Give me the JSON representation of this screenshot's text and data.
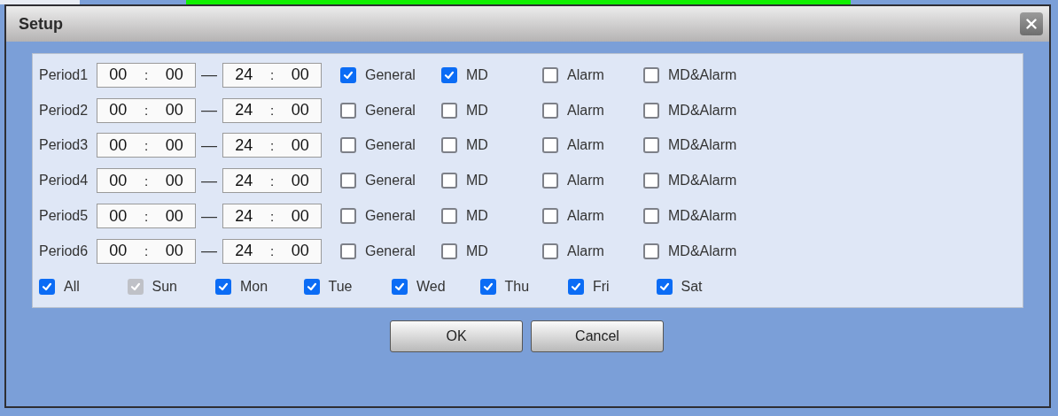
{
  "dialog": {
    "title": "Setup",
    "periods": [
      {
        "label": "Period1",
        "start": {
          "hour": "00",
          "sep": ":",
          "minute": "00"
        },
        "dash": "—",
        "end": {
          "hour": "24",
          "sep": ":",
          "minute": "00"
        },
        "options": [
          {
            "label": "General",
            "checked": true
          },
          {
            "label": "MD",
            "checked": true
          },
          {
            "label": "Alarm",
            "checked": false
          },
          {
            "label": "MD&Alarm",
            "checked": false
          }
        ]
      },
      {
        "label": "Period2",
        "start": {
          "hour": "00",
          "sep": ":",
          "minute": "00"
        },
        "dash": "—",
        "end": {
          "hour": "24",
          "sep": ":",
          "minute": "00"
        },
        "options": [
          {
            "label": "General",
            "checked": false
          },
          {
            "label": "MD",
            "checked": false
          },
          {
            "label": "Alarm",
            "checked": false
          },
          {
            "label": "MD&Alarm",
            "checked": false
          }
        ]
      },
      {
        "label": "Period3",
        "start": {
          "hour": "00",
          "sep": ":",
          "minute": "00"
        },
        "dash": "—",
        "end": {
          "hour": "24",
          "sep": ":",
          "minute": "00"
        },
        "options": [
          {
            "label": "General",
            "checked": false
          },
          {
            "label": "MD",
            "checked": false
          },
          {
            "label": "Alarm",
            "checked": false
          },
          {
            "label": "MD&Alarm",
            "checked": false
          }
        ]
      },
      {
        "label": "Period4",
        "start": {
          "hour": "00",
          "sep": ":",
          "minute": "00"
        },
        "dash": "—",
        "end": {
          "hour": "24",
          "sep": ":",
          "minute": "00"
        },
        "options": [
          {
            "label": "General",
            "checked": false
          },
          {
            "label": "MD",
            "checked": false
          },
          {
            "label": "Alarm",
            "checked": false
          },
          {
            "label": "MD&Alarm",
            "checked": false
          }
        ]
      },
      {
        "label": "Period5",
        "start": {
          "hour": "00",
          "sep": ":",
          "minute": "00"
        },
        "dash": "—",
        "end": {
          "hour": "24",
          "sep": ":",
          "minute": "00"
        },
        "options": [
          {
            "label": "General",
            "checked": false
          },
          {
            "label": "MD",
            "checked": false
          },
          {
            "label": "Alarm",
            "checked": false
          },
          {
            "label": "MD&Alarm",
            "checked": false
          }
        ]
      },
      {
        "label": "Period6",
        "start": {
          "hour": "00",
          "sep": ":",
          "minute": "00"
        },
        "dash": "—",
        "end": {
          "hour": "24",
          "sep": ":",
          "minute": "00"
        },
        "options": [
          {
            "label": "General",
            "checked": false
          },
          {
            "label": "MD",
            "checked": false
          },
          {
            "label": "Alarm",
            "checked": false
          },
          {
            "label": "MD&Alarm",
            "checked": false
          }
        ]
      }
    ],
    "days": [
      {
        "label": "All",
        "checked": true,
        "disabled": false
      },
      {
        "label": "Sun",
        "checked": true,
        "disabled": true
      },
      {
        "label": "Mon",
        "checked": true,
        "disabled": false
      },
      {
        "label": "Tue",
        "checked": true,
        "disabled": false
      },
      {
        "label": "Wed",
        "checked": true,
        "disabled": false
      },
      {
        "label": "Thu",
        "checked": true,
        "disabled": false
      },
      {
        "label": "Fri",
        "checked": true,
        "disabled": false
      },
      {
        "label": "Sat",
        "checked": true,
        "disabled": false
      }
    ],
    "buttons": [
      "OK",
      "Cancel"
    ]
  }
}
